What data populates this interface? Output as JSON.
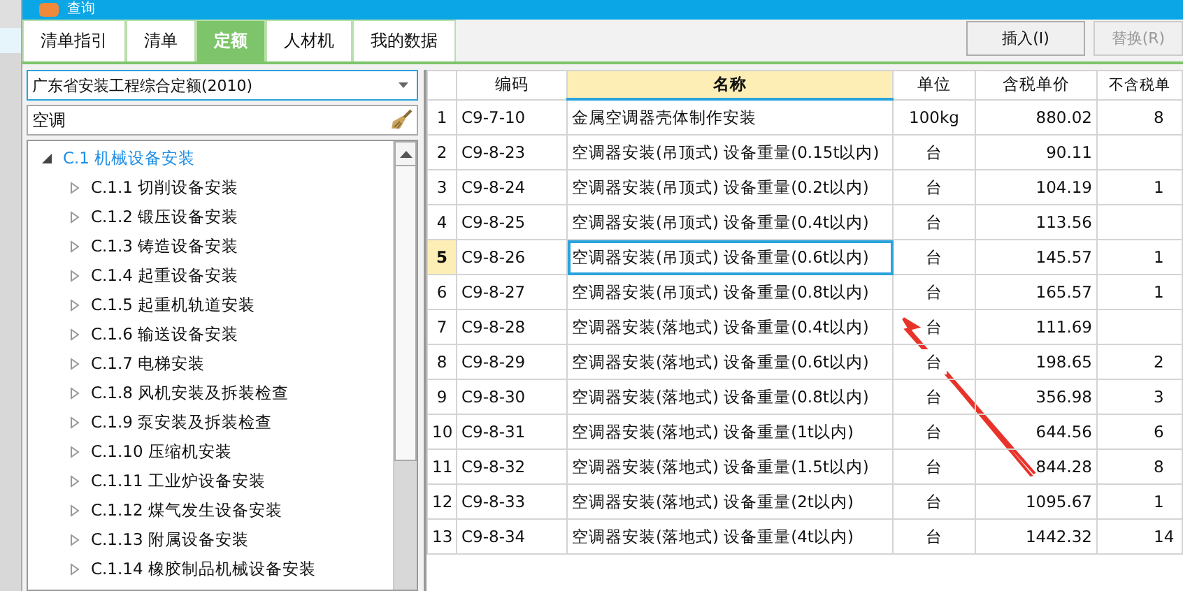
{
  "window": {
    "title": "查询"
  },
  "tabs": [
    {
      "label": "清单指引",
      "selected": false
    },
    {
      "label": "清单",
      "selected": false
    },
    {
      "label": "定额",
      "selected": true
    },
    {
      "label": "人材机",
      "selected": false
    },
    {
      "label": "我的数据",
      "selected": false
    }
  ],
  "buttons": [
    {
      "label": "插入(I)",
      "disabled": false
    },
    {
      "label": "替换(R)",
      "disabled": true
    }
  ],
  "library_select": {
    "value": "广东省安装工程综合定额(2010)"
  },
  "search": {
    "value": "空调"
  },
  "tree": [
    {
      "label": "C.1 机械设备安装",
      "expanded": true,
      "selected": true,
      "children": [
        {
          "label": "C.1.1 切削设备安装",
          "expanded": false,
          "selected": false
        },
        {
          "label": "C.1.2 锻压设备安装",
          "expanded": false,
          "selected": false
        },
        {
          "label": "C.1.3 铸造设备安装",
          "expanded": false,
          "selected": false
        },
        {
          "label": "C.1.4 起重设备安装",
          "expanded": false,
          "selected": false
        },
        {
          "label": "C.1.5 起重机轨道安装",
          "expanded": false,
          "selected": false
        },
        {
          "label": "C.1.6 输送设备安装",
          "expanded": false,
          "selected": false
        },
        {
          "label": "C.1.7 电梯安装",
          "expanded": false,
          "selected": false
        },
        {
          "label": "C.1.8 风机安装及拆装检查",
          "expanded": false,
          "selected": false
        },
        {
          "label": "C.1.9 泵安装及拆装检查",
          "expanded": false,
          "selected": false
        },
        {
          "label": "C.1.10 压缩机安装",
          "expanded": false,
          "selected": false
        },
        {
          "label": "C.1.11 工业炉设备安装",
          "expanded": false,
          "selected": false
        },
        {
          "label": "C.1.12 煤气发生设备安装",
          "expanded": false,
          "selected": false
        },
        {
          "label": "C.1.13 附属设备安装",
          "expanded": false,
          "selected": false
        },
        {
          "label": "C.1.14 橡胶制品机械设备安装",
          "expanded": false,
          "selected": false
        }
      ]
    }
  ],
  "table": {
    "columns": [
      "编码",
      "名称",
      "单位",
      "含税单价",
      "不含税单"
    ],
    "rows": [
      {
        "num": "1",
        "code": "C9-7-10",
        "name": "金属空调器壳体制作安装",
        "unit": "100kg",
        "price": "880.02",
        "column_5": "8",
        "selected": false
      },
      {
        "num": "2",
        "code": "C9-8-23",
        "name": "空调器安装(吊顶式) 设备重量(0.15t以内)",
        "unit": "台",
        "price": "90.11",
        "selected": false
      },
      {
        "num": "3",
        "code": "C9-8-24",
        "name": "空调器安装(吊顶式) 设备重量(0.2t以内)",
        "unit": "台",
        "price": "104.19",
        "column_5": "1",
        "selected": false
      },
      {
        "num": "4",
        "code": "C9-8-25",
        "name": "空调器安装(吊顶式) 设备重量(0.4t以内)",
        "unit": "台",
        "price": "113.56",
        "selected": false
      },
      {
        "num": "5",
        "code": "C9-8-26",
        "name": "空调器安装(吊顶式) 设备重量(0.6t以内)",
        "unit": "台",
        "price": "145.57",
        "column_5": "1",
        "selected": true
      },
      {
        "num": "6",
        "code": "C9-8-27",
        "name": "空调器安装(吊顶式) 设备重量(0.8t以内)",
        "unit": "台",
        "price": "165.57",
        "column_5": "1",
        "selected": false
      },
      {
        "num": "7",
        "code": "C9-8-28",
        "name": "空调器安装(落地式) 设备重量(0.4t以内)",
        "unit": "台",
        "price": "111.69",
        "selected": false
      },
      {
        "num": "8",
        "code": "C9-8-29",
        "name": "空调器安装(落地式) 设备重量(0.6t以内)",
        "unit": "台",
        "price": "198.65",
        "column_5": "2",
        "selected": false
      },
      {
        "num": "9",
        "code": "C9-8-30",
        "name": "空调器安装(落地式) 设备重量(0.8t以内)",
        "unit": "台",
        "price": "356.98",
        "column_5": "3",
        "selected": false
      },
      {
        "num": "10",
        "code": "C9-8-31",
        "name": "空调器安装(落地式) 设备重量(1t以内)",
        "unit": "台",
        "price": "644.56",
        "column_5": "6",
        "selected": false
      },
      {
        "num": "11",
        "code": "C9-8-32",
        "name": "空调器安装(落地式) 设备重量(1.5t以内)",
        "unit": "台",
        "price": "844.28",
        "column_5": "8",
        "selected": false
      },
      {
        "num": "12",
        "code": "C9-8-33",
        "name": "空调器安装(落地式) 设备重量(2t以内)",
        "unit": "台",
        "price": "1095.67",
        "column_5": "1",
        "selected": false
      },
      {
        "num": "13",
        "code": "C9-8-34",
        "name": "空调器安装(落地式) 设备重量(4t以内)",
        "unit": "台",
        "price": "1442.32",
        "column_5": "14",
        "selected": false
      }
    ]
  }
}
